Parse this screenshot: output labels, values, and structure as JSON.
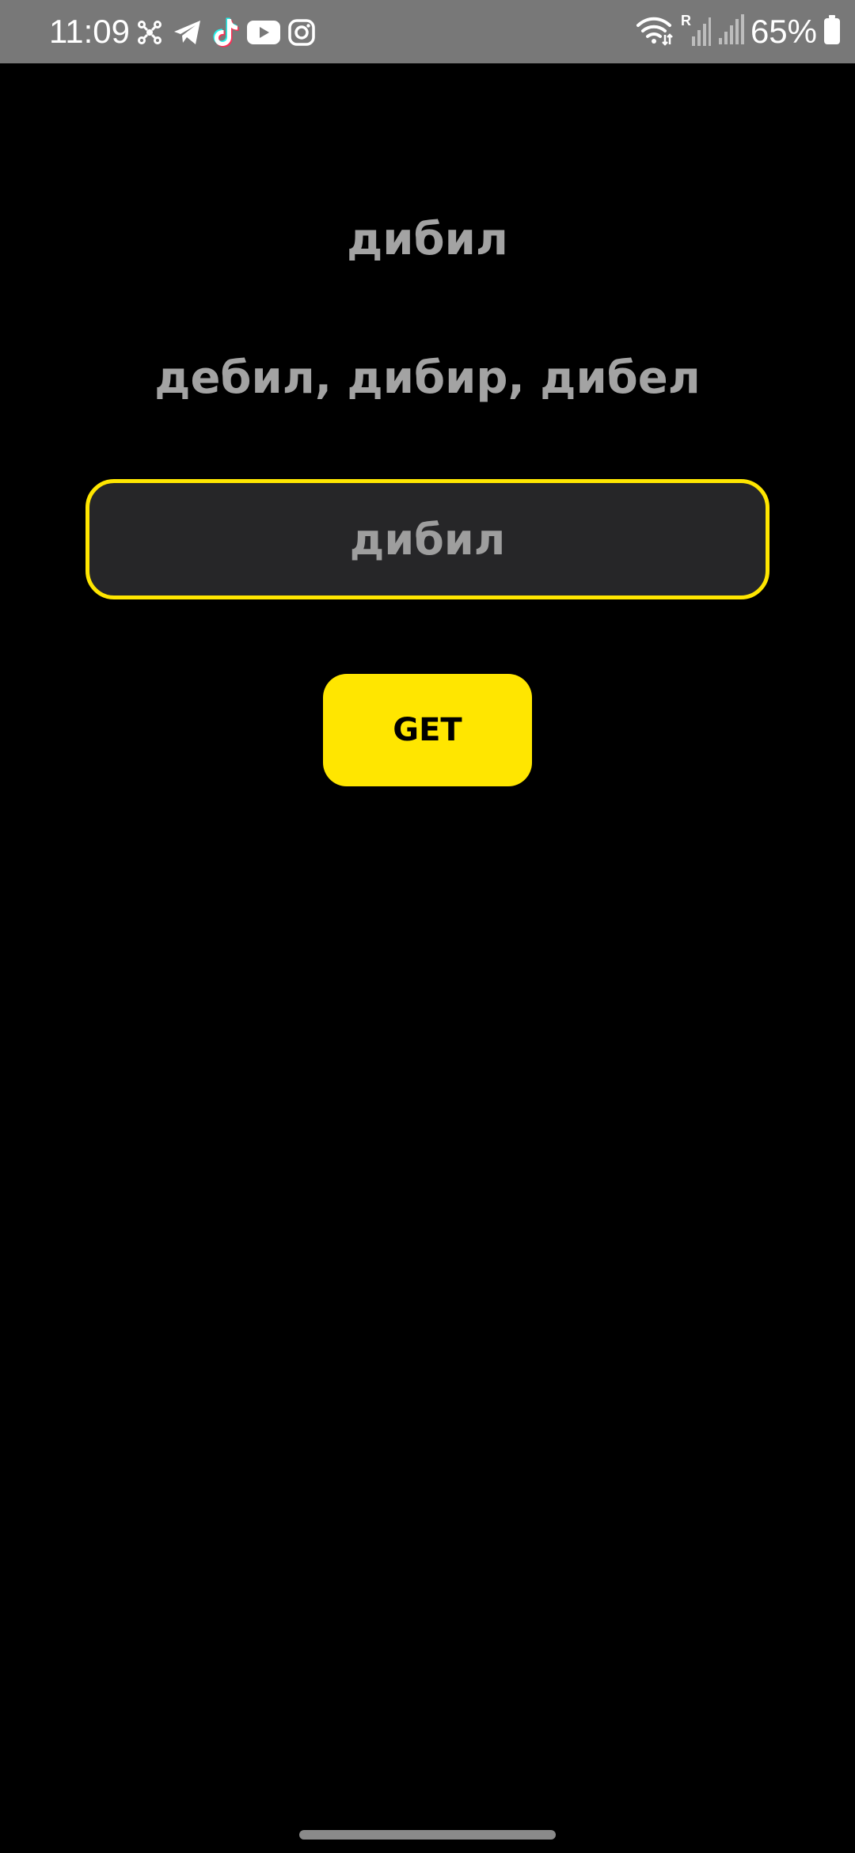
{
  "status_bar": {
    "time": "11:09",
    "battery_percent": "65%",
    "notification_icons": [
      "network-hub-icon",
      "telegram-icon",
      "tiktok-icon",
      "youtube-icon",
      "instagram-icon"
    ],
    "right_icons": [
      "wifi-icon",
      "roaming-signal-icon",
      "signal-icon",
      "battery-icon"
    ],
    "roaming_label": "R",
    "background_color": "#787878"
  },
  "main": {
    "word": "дибил",
    "suggestions": "дебил, дибир, дибел",
    "input": {
      "value": "дибил"
    },
    "get_button_label": "GET"
  },
  "colors": {
    "accent": "#ffe600",
    "background": "#000000",
    "input_background": "#262628",
    "text_muted": "#a3a3a3"
  }
}
